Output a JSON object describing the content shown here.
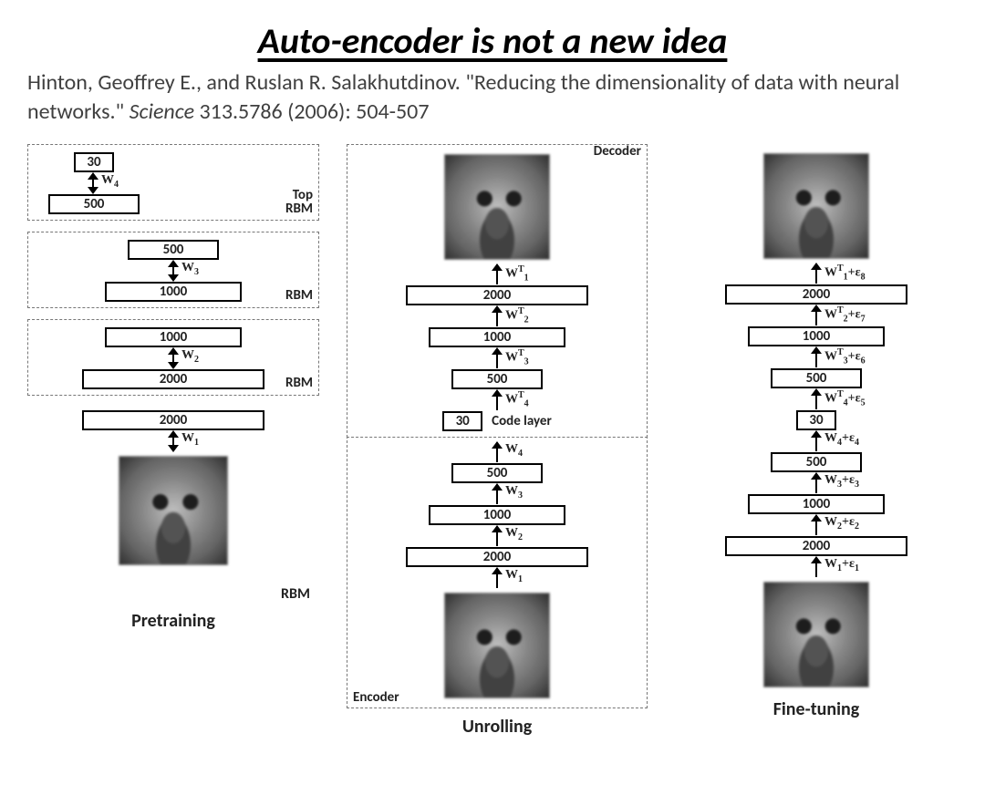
{
  "title": "Auto-encoder is not a new idea",
  "citation": {
    "authors": "Hinton, Geoffrey E., and Ruslan R. Salakhutdinov.",
    "paper_title": "\"Reducing the dimensionality of data with neural networks.\"",
    "journal": "Science",
    "ref": "313.5786 (2006): 504-507"
  },
  "captions": {
    "pretrain": "Pretraining",
    "unroll": "Unrolling",
    "finetune": "Fine-tuning"
  },
  "labels": {
    "rbm": "RBM",
    "top_rbm": "Top\nRBM",
    "encoder": "Encoder",
    "decoder": "Decoder",
    "code_layer": "Code layer"
  },
  "layers": {
    "l30": "30",
    "l500": "500",
    "l1000": "1000",
    "l2000": "2000"
  },
  "weights": {
    "w1": "W",
    "w1_sub": "1",
    "w2": "W",
    "w2_sub": "2",
    "w3": "W",
    "w3_sub": "3",
    "w4": "W",
    "w4_sub": "4",
    "t": "T",
    "eps_pre": "+ε",
    "e1": "1",
    "e2": "2",
    "e3": "3",
    "e4": "4",
    "e5": "5",
    "e6": "6",
    "e7": "7",
    "e8": "8"
  }
}
